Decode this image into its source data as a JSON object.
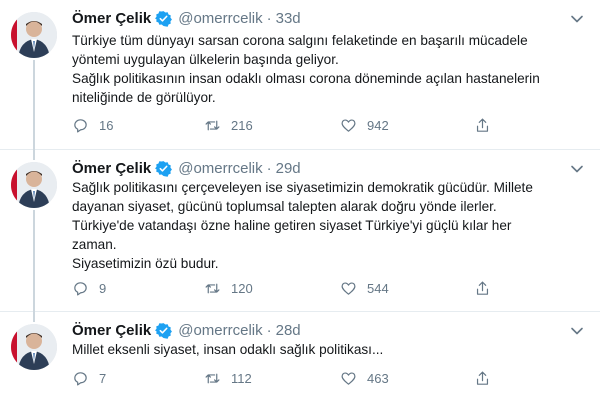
{
  "tweets": [
    {
      "name": "Ömer Çelik",
      "handle": "@omerrcelik",
      "separator": "·",
      "time": "33d",
      "lines": [
        "Türkiye tüm dünyayı sarsan corona salgını felaketinde en başarılı mücadele",
        "yöntemi uygulayan ülkelerin başında geliyor.",
        "Sağlık politikasının insan odaklı olması corona döneminde açılan hastanelerin",
        "niteliğinde de görülüyor."
      ],
      "replies": "16",
      "retweets": "216",
      "likes": "942"
    },
    {
      "name": "Ömer Çelik",
      "handle": "@omerrcelik",
      "separator": "·",
      "time": "29d",
      "lines": [
        "Sağlık politikasını çerçeveleyen ise siyasetimizin demokratik gücüdür. Millete",
        "dayanan siyaset, gücünü toplumsal talepten alarak doğru yönde ilerler.",
        "Türkiye'de vatandaşı özne haline getiren siyaset Türkiye'yi güçlü kılar her",
        "zaman.",
        "Siyasetimizin özü budur."
      ],
      "replies": "9",
      "retweets": "120",
      "likes": "544"
    },
    {
      "name": "Ömer Çelik",
      "handle": "@omerrcelik",
      "separator": "·",
      "time": "28d",
      "lines": [
        "Millet eksenli siyaset, insan odaklı sağlık politikası..."
      ],
      "replies": "7",
      "retweets": "112",
      "likes": "463"
    }
  ],
  "icons": {
    "verified": "verified-badge-icon",
    "caret": "chevron-down-icon",
    "reply": "reply-icon",
    "retweet": "retweet-icon",
    "like": "heart-icon",
    "share": "share-icon"
  },
  "colors": {
    "verified": "#1da1f2",
    "text": "#14171a",
    "muted": "#657786",
    "divider": "#e6ecf0",
    "thread_line": "#ccd6dd"
  }
}
